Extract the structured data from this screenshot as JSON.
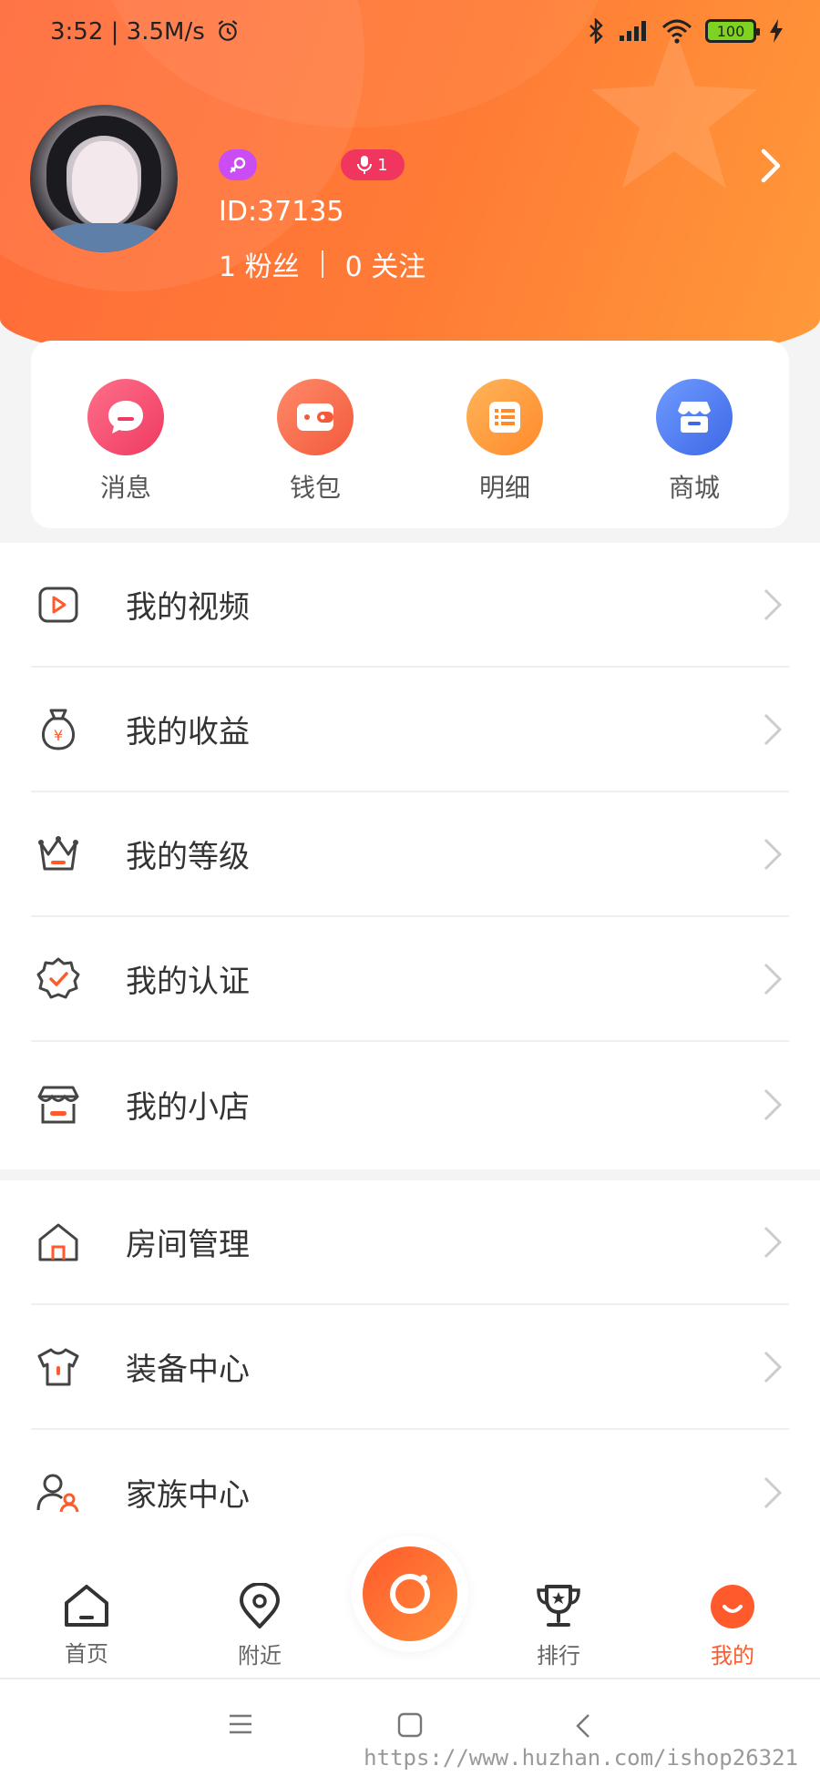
{
  "status_bar": {
    "time": "3:52 | 3.5M/s",
    "battery": "100"
  },
  "profile": {
    "mic_badge_count": "1",
    "user_id": "ID:37135",
    "fans": "1 粉丝",
    "following": "0 关注"
  },
  "quick_actions": [
    {
      "label": "消息",
      "icon": "chat-bubble-icon",
      "color": "#f0426b"
    },
    {
      "label": "钱包",
      "icon": "wallet-icon",
      "color": "#fb6d48"
    },
    {
      "label": "明细",
      "icon": "list-icon",
      "color": "#ff9a3a"
    },
    {
      "label": "商城",
      "icon": "shop-icon",
      "color": "#4d7df0"
    }
  ],
  "menu_section_1": [
    {
      "label": "我的视频",
      "icon": "video-icon"
    },
    {
      "label": "我的收益",
      "icon": "money-bag-icon"
    },
    {
      "label": "我的等级",
      "icon": "crown-icon"
    },
    {
      "label": "我的认证",
      "icon": "certified-badge-icon"
    },
    {
      "label": "我的小店",
      "icon": "store-icon"
    }
  ],
  "menu_section_2": [
    {
      "label": "房间管理",
      "icon": "house-icon"
    },
    {
      "label": "装备中心",
      "icon": "shirt-icon"
    },
    {
      "label": "家族中心",
      "icon": "family-icon"
    }
  ],
  "tabbar": {
    "home": "首页",
    "nearby": "附近",
    "ranking": "排行",
    "mine": "我的"
  },
  "watermark": "https://www.huzhan.com/ishop26321",
  "colors": {
    "accent": "#ff5a2c",
    "header_start": "#ff6a3a",
    "header_end": "#ff9a3a"
  }
}
